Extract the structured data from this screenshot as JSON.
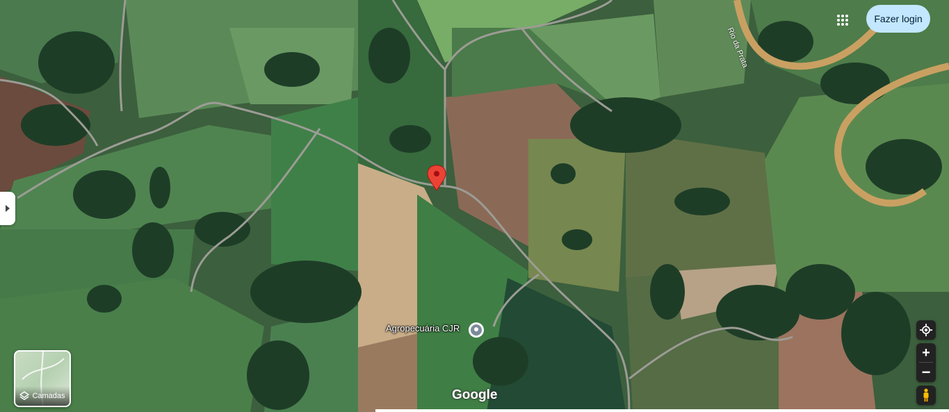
{
  "header": {
    "login_label": "Fazer login",
    "apps_icon": "apps-grid-icon"
  },
  "map": {
    "poi_label": "Agropecuária CJR",
    "river_label": "Rio da Prata",
    "attribution": "Google",
    "pin_color": "#ea4335"
  },
  "controls": {
    "layers_label": "Camadas",
    "zoom_in_label": "+",
    "zoom_out_label": "−",
    "my_location_icon": "my-location-icon",
    "pegman_icon": "pegman-icon",
    "expand_icon": "expand-panel-icon"
  }
}
